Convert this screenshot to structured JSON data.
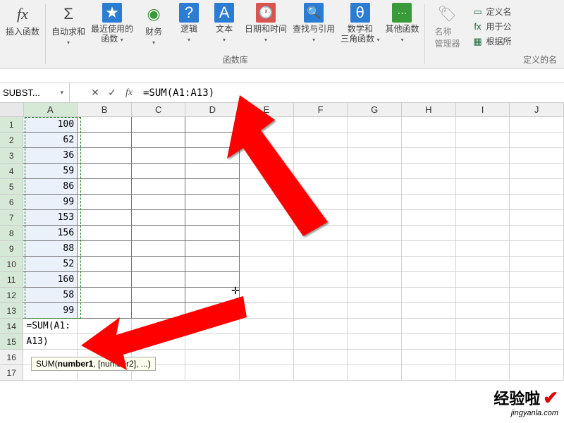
{
  "ribbon": {
    "insert_fn": "插入函数",
    "autosum": "自动求和",
    "recent": "最近使用的\n函数",
    "finance": "财务",
    "logic": "逻辑",
    "text": "文本",
    "datetime": "日期和时间",
    "lookup": "查找与引用",
    "math": "数学和\n三角函数",
    "other": "其他函数",
    "group_lib": "函数库",
    "name_mgr": "名称\n管理器",
    "define_name": "定义名",
    "use_in_formula": "用于公",
    "create_from_sel": "根据所",
    "group_names": "定义的名"
  },
  "formula_bar": {
    "name_box": "SUBST...",
    "formula": "=SUM(A1:A13)"
  },
  "columns": [
    "A",
    "B",
    "C",
    "D",
    "E",
    "F",
    "G",
    "H",
    "I",
    "J"
  ],
  "rows": [
    {
      "n": 1,
      "a": "100"
    },
    {
      "n": 2,
      "a": "62"
    },
    {
      "n": 3,
      "a": "36"
    },
    {
      "n": 4,
      "a": "59"
    },
    {
      "n": 5,
      "a": "86"
    },
    {
      "n": 6,
      "a": "99"
    },
    {
      "n": 7,
      "a": "153"
    },
    {
      "n": 8,
      "a": "156"
    },
    {
      "n": 9,
      "a": "88"
    },
    {
      "n": 10,
      "a": "52"
    },
    {
      "n": 11,
      "a": "160"
    },
    {
      "n": 12,
      "a": "58"
    },
    {
      "n": 13,
      "a": "99"
    },
    {
      "n": 14,
      "a": "=SUM(A1:"
    },
    {
      "n": 15,
      "a": "A13)"
    },
    {
      "n": 16,
      "a": ""
    },
    {
      "n": 17,
      "a": ""
    }
  ],
  "tooltip": {
    "fn": "SUM",
    "arg1": "number1",
    "rest": ", [number2], ...)"
  },
  "watermark": {
    "line1": "经验啦",
    "line2": "jingyanla.com"
  }
}
